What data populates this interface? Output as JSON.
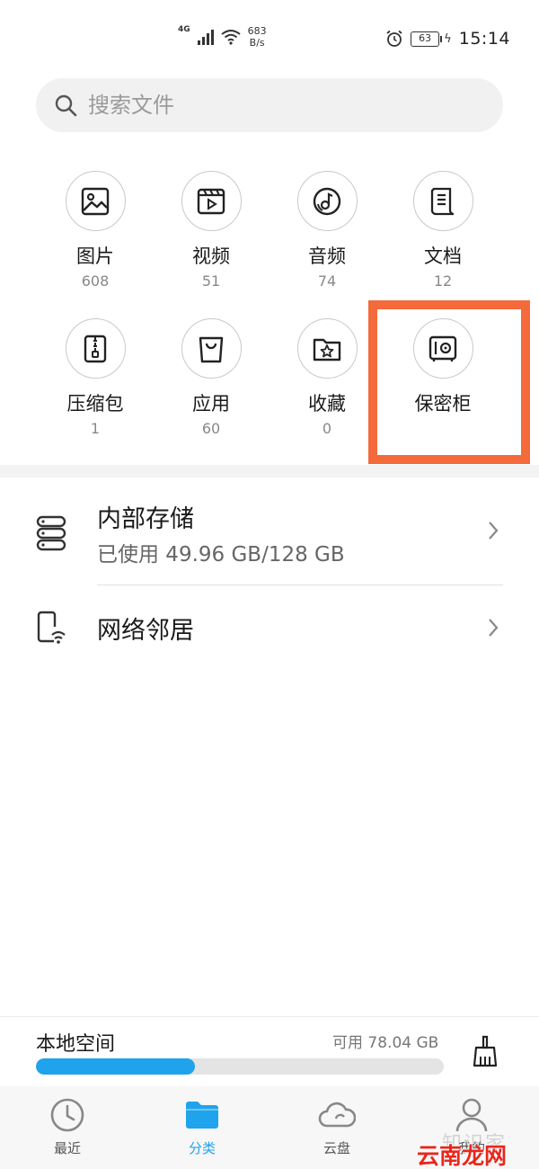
{
  "status_bar": {
    "network": "4G",
    "speed_value": "683",
    "speed_unit": "B/s",
    "battery": "63",
    "time": "15:14"
  },
  "search": {
    "placeholder": "搜索文件"
  },
  "categories": [
    {
      "label": "图片",
      "count": "608",
      "icon": "image-icon"
    },
    {
      "label": "视频",
      "count": "51",
      "icon": "video-icon"
    },
    {
      "label": "音频",
      "count": "74",
      "icon": "music-disc-icon"
    },
    {
      "label": "文档",
      "count": "12",
      "icon": "document-icon"
    },
    {
      "label": "压缩包",
      "count": "1",
      "icon": "zip-icon"
    },
    {
      "label": "应用",
      "count": "60",
      "icon": "shopping-bag-icon"
    },
    {
      "label": "收藏",
      "count": "0",
      "icon": "favorite-folder-icon"
    },
    {
      "label": "保密柜",
      "count": "",
      "icon": "safe-icon"
    }
  ],
  "storage": {
    "internal": {
      "title": "内部存储",
      "usage": "已使用 49.96 GB/128 GB",
      "icon": "storage-icon"
    },
    "network": {
      "title": "网络邻居",
      "icon": "network-device-icon"
    }
  },
  "local_space": {
    "title": "本地空间",
    "free": "可用 78.04 GB",
    "used_fraction": 0.39
  },
  "bottom_nav": [
    {
      "label": "最近",
      "icon": "clock-icon",
      "active": false
    },
    {
      "label": "分类",
      "icon": "folder-icon",
      "active": true
    },
    {
      "label": "云盘",
      "icon": "cloud-icon",
      "active": false
    },
    {
      "label": "我的",
      "icon": "user-icon",
      "active": false
    }
  ],
  "watermark": {
    "ghost": "知识家",
    "text": "云南龙网"
  },
  "colors": {
    "accent": "#1fa3ec",
    "highlight": "#f46a3a"
  }
}
